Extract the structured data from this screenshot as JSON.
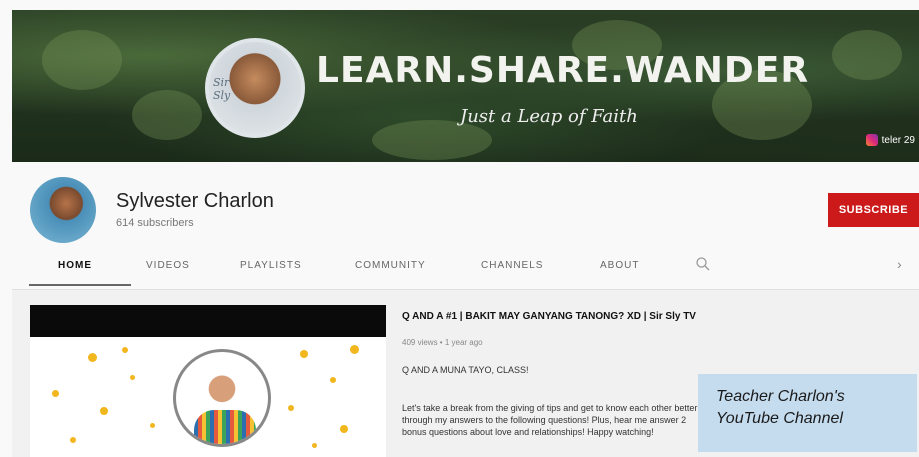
{
  "banner": {
    "title": "LEARN.SHARE.WANDER",
    "subtitle": "Just a Leap of Faith",
    "instagram_handle": "teler 29"
  },
  "channel": {
    "name": "Sylvester Charlon",
    "subscribers": "614 subscribers",
    "subscribe_label": "SUBSCRIBE"
  },
  "tabs": [
    {
      "label": "HOME",
      "active": true
    },
    {
      "label": "VIDEOS",
      "active": false
    },
    {
      "label": "PLAYLISTS",
      "active": false
    },
    {
      "label": "COMMUNITY",
      "active": false
    },
    {
      "label": "CHANNELS",
      "active": false
    },
    {
      "label": "ABOUT",
      "active": false
    }
  ],
  "featured_video": {
    "title": "Q AND A #1 | BAKIT MAY GANYANG TANONG? XD | Sir Sly TV",
    "meta": "409 views • 1 year ago",
    "desc_heading": "Q AND A MUNA TAYO, CLASS!",
    "desc_body": "Let's take a break from the giving of tips and get to know each other better through my answers to the following questions! Plus, hear me answer 2 bonus questions about love and relationships! Happy watching!"
  },
  "caption": {
    "line1": "Teacher Charlon's",
    "line2": "YouTube Channel"
  },
  "colors": {
    "subscribe_red": "#cc1a1a",
    "caption_bg": "#c5dbee"
  },
  "icons": [
    "search-icon",
    "chevron-right-icon",
    "instagram-icon"
  ]
}
